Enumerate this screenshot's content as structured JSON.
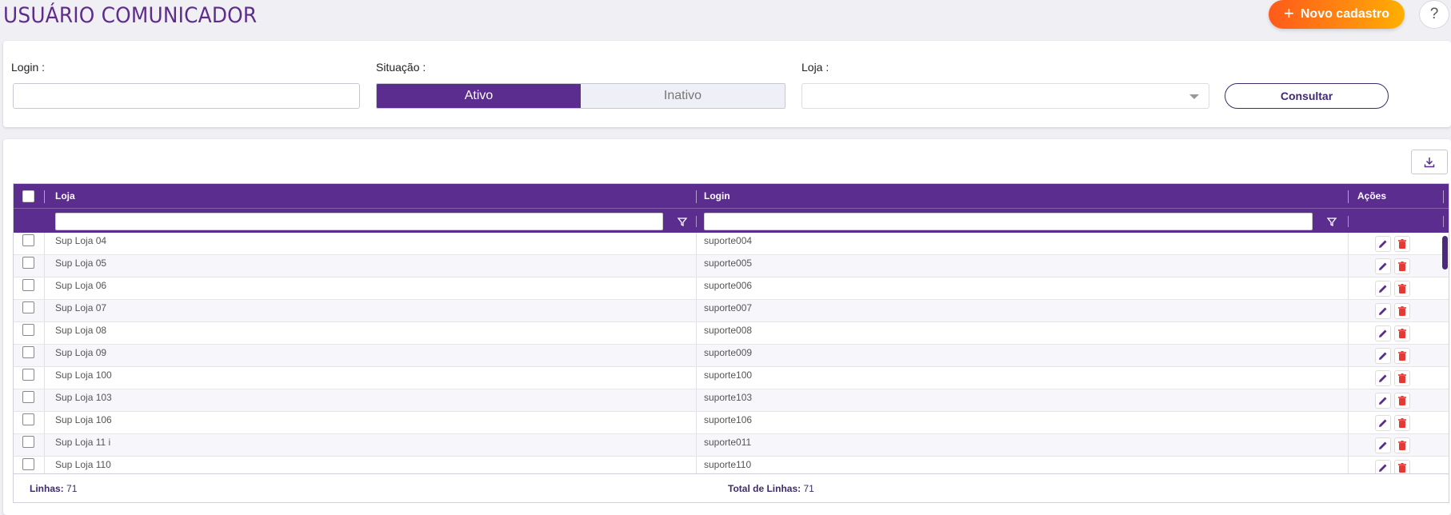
{
  "header": {
    "title": "USUÁRIO COMUNICADOR",
    "new_button": "Novo cadastro",
    "help": "?"
  },
  "filters": {
    "login_label": "Login :",
    "login_value": "",
    "situacao_label": "Situação :",
    "situacao_options": [
      "Ativo",
      "Inativo"
    ],
    "situacao_selected": "Ativo",
    "loja_label": "Loja :",
    "loja_value": "",
    "consultar": "Consultar"
  },
  "grid": {
    "columns": {
      "loja": "Loja",
      "login": "Login",
      "acoes": "Ações"
    },
    "rows": [
      {
        "loja": "Sup Loja 04",
        "login": "suporte004"
      },
      {
        "loja": "Sup Loja 05",
        "login": "suporte005"
      },
      {
        "loja": "Sup Loja 06",
        "login": "suporte006"
      },
      {
        "loja": "Sup Loja 07",
        "login": "suporte007"
      },
      {
        "loja": "Sup Loja 08",
        "login": "suporte008"
      },
      {
        "loja": "Sup Loja 09",
        "login": "suporte009"
      },
      {
        "loja": "Sup Loja 100",
        "login": "suporte100"
      },
      {
        "loja": "Sup Loja 103",
        "login": "suporte103"
      },
      {
        "loja": "Sup Loja 106",
        "login": "suporte106"
      },
      {
        "loja": "Sup Loja 11 i",
        "login": "suporte011"
      },
      {
        "loja": "Sup Loja 110",
        "login": "suporte110"
      }
    ],
    "footer": {
      "linhas_label": "Linhas:",
      "linhas_value": "71",
      "total_label": "Total de Linhas:",
      "total_value": "71"
    }
  },
  "icons": {
    "edit": "pencil-icon",
    "delete": "trash-icon",
    "export": "download-icon",
    "filter": "filter-icon",
    "add": "plus-icon"
  },
  "colors": {
    "brand": "#5b2d8e",
    "accent_start": "#ff5a1a",
    "accent_end": "#ffb000",
    "delete": "#e53935"
  }
}
